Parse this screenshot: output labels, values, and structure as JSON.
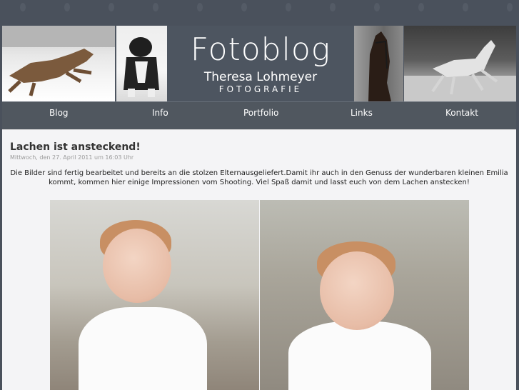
{
  "header": {
    "title": "Fotoblog",
    "photographer": "Theresa Lohmeyer",
    "subtitle": "FOTOGRAFIE"
  },
  "nav": {
    "items": [
      {
        "label": "Blog"
      },
      {
        "label": "Info"
      },
      {
        "label": "Portfolio"
      },
      {
        "label": "Links"
      },
      {
        "label": "Kontakt"
      }
    ]
  },
  "post": {
    "title": "Lachen ist ansteckend!",
    "date": "Mittwoch, den 27. April 2011 um 16:03 Uhr",
    "text": "Die Bilder sind fertig bearbeitet und bereits an die stolzen Elternausgeliefert.Damit ihr auch in den Genuss der wunderbaren kleinen Emilia kommt, kommen hier einige Impressionen vom Shooting. Viel Spaß damit und lasst euch von dem Lachen anstecken!"
  },
  "colors": {
    "page_bg": "#4a515c",
    "header_bg": "#4d5560",
    "content_bg": "#f4f4f6"
  }
}
